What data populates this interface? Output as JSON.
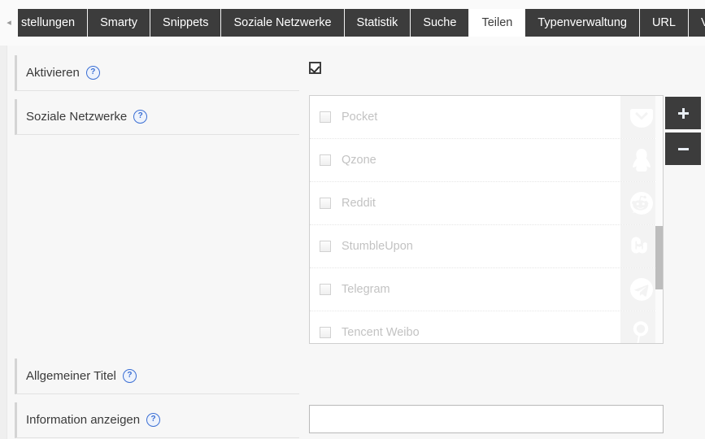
{
  "tabbar": {
    "scroll_left_icon": "chevron-left-icon",
    "tabs": [
      {
        "label": "stellungen",
        "active": false,
        "truncated": true
      },
      {
        "label": "Smarty",
        "active": false
      },
      {
        "label": "Snippets",
        "active": false
      },
      {
        "label": "Soziale Netzwerke",
        "active": false
      },
      {
        "label": "Statistik",
        "active": false
      },
      {
        "label": "Suche",
        "active": false
      },
      {
        "label": "Teilen",
        "active": true
      },
      {
        "label": "Typenverwaltung",
        "active": false
      },
      {
        "label": "URL",
        "active": false
      },
      {
        "label": "Verschiedenes",
        "active": false
      }
    ]
  },
  "form": {
    "rows": [
      {
        "label": "Aktivieren",
        "help_icon": "help-icon"
      },
      {
        "label": "Soziale Netzwerke",
        "help_icon": "help-icon"
      },
      {
        "label": "Allgemeiner Titel",
        "help_icon": "help-icon"
      },
      {
        "label": "Information anzeigen",
        "help_icon": "help-icon"
      }
    ],
    "aktivieren_checked": true,
    "information_anzeigen_checked": false,
    "allgemeiner_titel_value": "",
    "allgemeiner_titel_placeholder": ""
  },
  "networks": {
    "items": [
      {
        "name": "Pocket",
        "icon": "pocket-icon",
        "checked": false
      },
      {
        "name": "Qzone",
        "icon": "qzone-icon",
        "checked": false
      },
      {
        "name": "Reddit",
        "icon": "reddit-icon",
        "checked": false
      },
      {
        "name": "StumbleUpon",
        "icon": "stumbleupon-icon",
        "checked": false
      },
      {
        "name": "Telegram",
        "icon": "telegram-icon",
        "checked": false
      },
      {
        "name": "Tencent Weibo",
        "icon": "tencent-weibo-icon",
        "checked": false
      }
    ]
  },
  "side_buttons": {
    "add_label": "+",
    "remove_label": "−",
    "add_icon": "plus-icon",
    "remove_icon": "minus-icon"
  },
  "colors": {
    "tab_inactive_bg": "#3c3c3c",
    "tab_active_bg": "#ffffff",
    "page_bg": "#f7f7f7",
    "help_blue": "#3b6fd4",
    "button_bg": "#3c3c3c"
  }
}
